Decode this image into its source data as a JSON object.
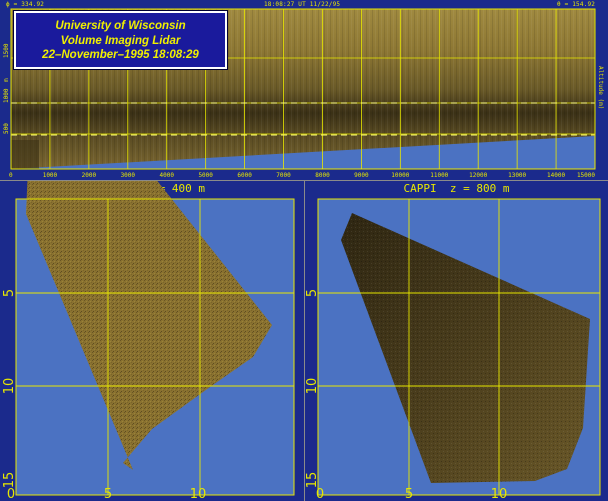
{
  "header": {
    "left_readout": "ϕ = 334.92",
    "center_timestamp": "18:08:27 UT 11/22/95",
    "right_readout": "θ = 154.92"
  },
  "title_box": {
    "line1": "University of Wisconsin",
    "line2": "Volume Imaging Lidar",
    "line3": "22–November–1995 18:08:29"
  },
  "rhi": {
    "x_ticks": [
      "0",
      "1000",
      "2000",
      "3000",
      "4000",
      "5000",
      "6000",
      "7000",
      "8000",
      "9000",
      "10000",
      "11000",
      "12000",
      "13000",
      "14000",
      "15000"
    ],
    "y_ticks": [
      "500",
      "1000",
      "1500"
    ],
    "y_unit": "m",
    "right_label": "Altitude (m)"
  },
  "cappi_left": {
    "title": "CAPPI  z = 400 m",
    "x_ticks": [
      "0",
      "5",
      "10"
    ],
    "y_ticks": [
      "5",
      "10",
      "15"
    ]
  },
  "cappi_right": {
    "title": "CAPPI  z = 800 m",
    "x_ticks": [
      "0",
      "5",
      "10"
    ],
    "y_ticks": [
      "5",
      "10",
      "15"
    ]
  },
  "colors": {
    "frame_blue": "#1b2a8c",
    "sky_blue": "#4b72c2",
    "grid_yellow": "#e8e800",
    "aerosol_tan": "#8a7230",
    "aerosol_dark": "#3e3418"
  }
}
